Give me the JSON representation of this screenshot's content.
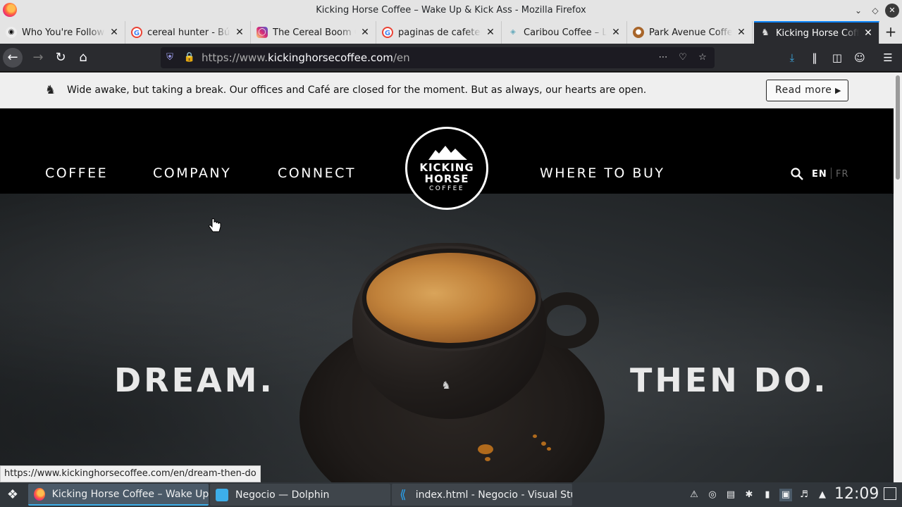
{
  "window": {
    "title": "Kicking Horse Coffee – Wake Up & Kick Ass - Mozilla Firefox"
  },
  "tabs": [
    {
      "label": "Who You're Following",
      "icon": "github-icon"
    },
    {
      "label": "cereal hunter - Búsqueda",
      "icon": "google-icon"
    },
    {
      "label": "The Cereal Boom Co",
      "icon": "instagram-icon"
    },
    {
      "label": "paginas de cafeterias",
      "icon": "google-icon"
    },
    {
      "label": "Caribou Coffee – Life",
      "icon": "caribou-icon"
    },
    {
      "label": "Park Avenue Coffee",
      "icon": "parkavenue-icon"
    },
    {
      "label": "Kicking Horse Coffee",
      "icon": "horse-icon",
      "active": true
    }
  ],
  "navbar": {
    "url_prefix": "https://www.",
    "url_domain": "kickinghorsecoffee.com",
    "url_path": "/en"
  },
  "page": {
    "notice": {
      "message": "Wide awake, but taking a break. Our offices and Café are closed for the moment. But as always, our hearts are open.",
      "read_more": "Read more"
    },
    "nav": {
      "coffee": "COFFEE",
      "company": "COMPANY",
      "connect": "CONNECT",
      "where_to_buy": "WHERE TO BUY",
      "lang_en": "EN",
      "lang_fr": "FR"
    },
    "logo": {
      "line1": "KICKING",
      "line2": "HORSE",
      "line3": "COFFEE"
    },
    "hero": {
      "left_text": "DREAM.",
      "right_text": "THEN DO."
    },
    "status_url": "https://www.kickinghorsecoffee.com/en/dream-then-do"
  },
  "taskbar": {
    "tasks": [
      {
        "label": "Kicking Horse Coffee – Wake Up & ..."
      },
      {
        "label": "Negocio — Dolphin"
      },
      {
        "label": "index.html - Negocio - Visual Studi..."
      }
    ],
    "clock": "12:09"
  },
  "colors": {
    "tab_active_bg": "#2a2b2f",
    "accent": "#0a84ff",
    "taskbar_bg": "#31363b"
  }
}
